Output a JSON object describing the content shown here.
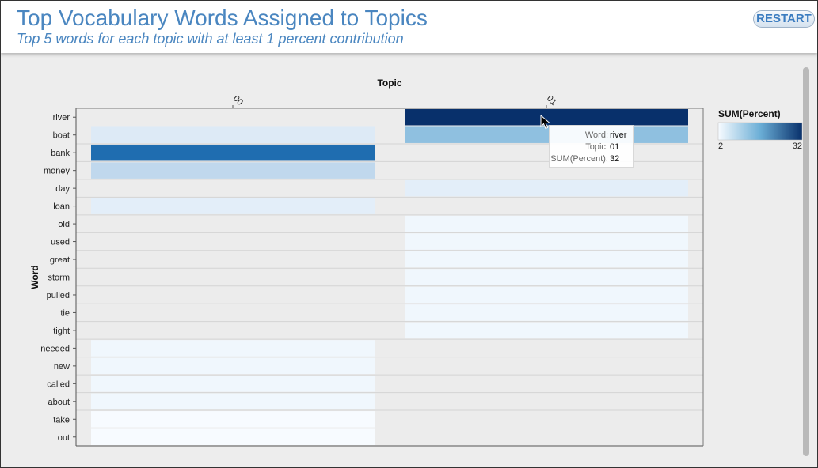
{
  "header": {
    "title": "Top Vocabulary Words Assigned to Topics",
    "subtitle": "Top 5 words for each topic with at least 1 percent contribution",
    "restart_label": "RESTART"
  },
  "chart_data": {
    "type": "heatmap",
    "x_axis_title": "Topic",
    "y_axis_title": "Word",
    "topics": [
      "00",
      "01"
    ],
    "words": [
      "river",
      "boat",
      "bank",
      "money",
      "day",
      "loan",
      "old",
      "used",
      "great",
      "storm",
      "pulled",
      "tie",
      "tight",
      "needed",
      "new",
      "called",
      "about",
      "take",
      "out"
    ],
    "cells": [
      {
        "topic": "00",
        "word": "boat",
        "value": 6
      },
      {
        "topic": "00",
        "word": "bank",
        "value": 25
      },
      {
        "topic": "00",
        "word": "money",
        "value": 10
      },
      {
        "topic": "00",
        "word": "loan",
        "value": 5
      },
      {
        "topic": "00",
        "word": "needed",
        "value": 3
      },
      {
        "topic": "00",
        "word": "new",
        "value": 3
      },
      {
        "topic": "00",
        "word": "called",
        "value": 3
      },
      {
        "topic": "00",
        "word": "about",
        "value": 3
      },
      {
        "topic": "00",
        "word": "take",
        "value": 2
      },
      {
        "topic": "00",
        "word": "out",
        "value": 2
      },
      {
        "topic": "01",
        "word": "river",
        "value": 32
      },
      {
        "topic": "01",
        "word": "boat",
        "value": 14
      },
      {
        "topic": "01",
        "word": "day",
        "value": 5
      },
      {
        "topic": "01",
        "word": "old",
        "value": 3
      },
      {
        "topic": "01",
        "word": "used",
        "value": 3
      },
      {
        "topic": "01",
        "word": "great",
        "value": 3
      },
      {
        "topic": "01",
        "word": "storm",
        "value": 3
      },
      {
        "topic": "01",
        "word": "pulled",
        "value": 3
      },
      {
        "topic": "01",
        "word": "tie",
        "value": 3
      },
      {
        "topic": "01",
        "word": "tight",
        "value": 3
      }
    ],
    "legend": {
      "title": "SUM(Percent)",
      "min": 2,
      "max": 32,
      "min_label": "2",
      "max_label": "32",
      "color_low": "#f7fbff",
      "color_high": "#08306b"
    },
    "grid": true
  },
  "tooltip": {
    "rows": [
      {
        "key": "Word:",
        "value": "river"
      },
      {
        "key": "Topic:",
        "value": "01"
      },
      {
        "key": "SUM(Percent):",
        "value": "32"
      }
    ]
  }
}
